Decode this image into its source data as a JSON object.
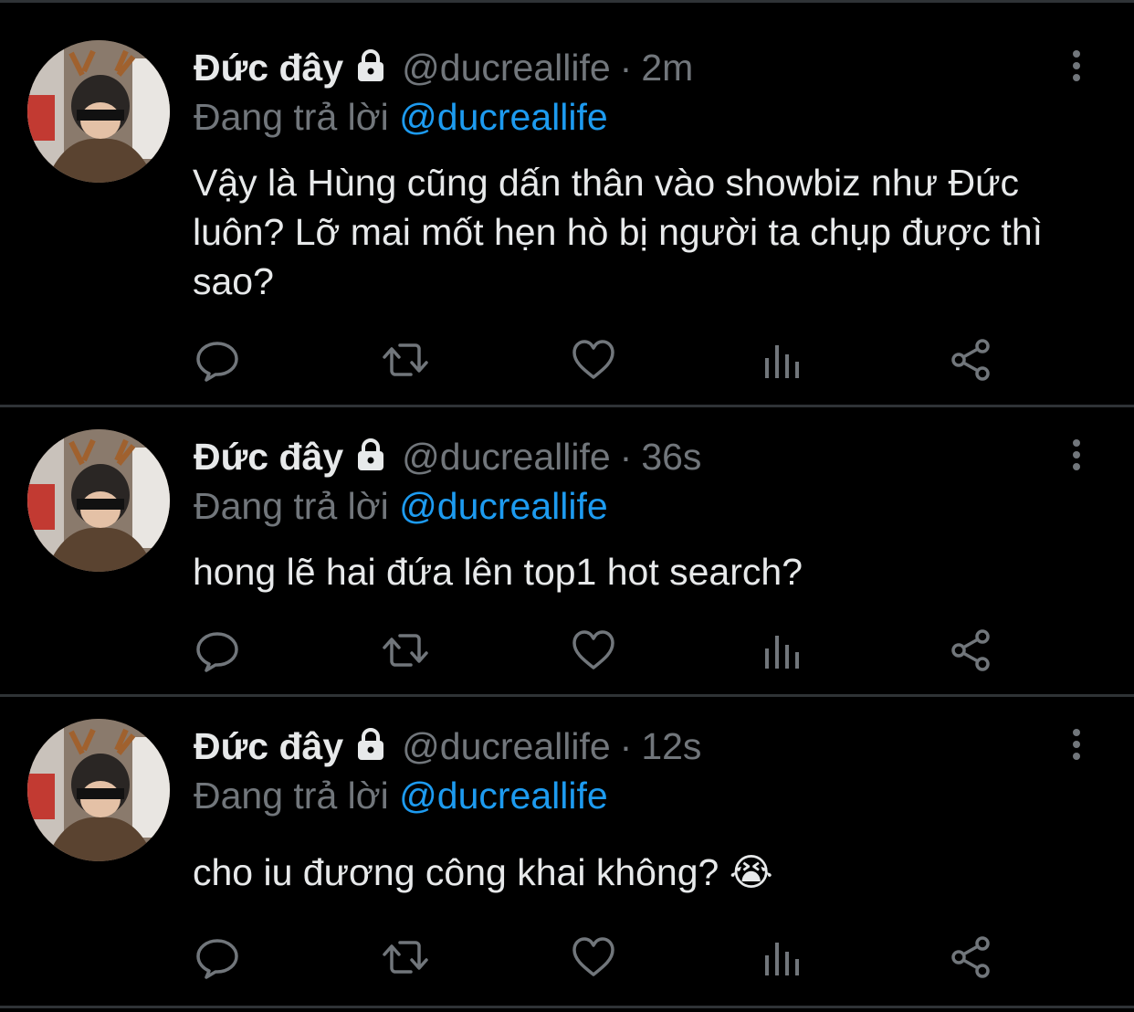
{
  "tweets": [
    {
      "name": "Đức đây",
      "handle": "@ducreallife",
      "separator": "·",
      "time": "2m",
      "reply_prefix": "Đang trả lời",
      "reply_to": "@ducreallife",
      "text": "Vậy là Hùng cũng dấn thân vào showbiz như Đức luôn? Lỡ mai mốt hẹn hò bị người ta chụp được thì sao?",
      "emoji": ""
    },
    {
      "name": "Đức đây",
      "handle": "@ducreallife",
      "separator": "·",
      "time": "36s",
      "reply_prefix": "Đang trả lời",
      "reply_to": "@ducreallife",
      "text": "hong lẽ hai đứa lên top1 hot search?",
      "emoji": ""
    },
    {
      "name": "Đức đây",
      "handle": "@ducreallife",
      "separator": "·",
      "time": "12s",
      "reply_prefix": "Đang trả lời",
      "reply_to": "@ducreallife",
      "text": "cho iu đương công khai không? ",
      "emoji": "😭"
    }
  ],
  "icons": {
    "account": "lock-icon",
    "menu": "more-vertical-icon",
    "actions": [
      "reply-icon",
      "retweet-icon",
      "like-icon",
      "analytics-icon",
      "share-icon"
    ]
  },
  "colors": {
    "background": "#000000",
    "text": "#e7e9ea",
    "muted": "#71767b",
    "link": "#1d9bf0",
    "divider": "#2f3336"
  }
}
